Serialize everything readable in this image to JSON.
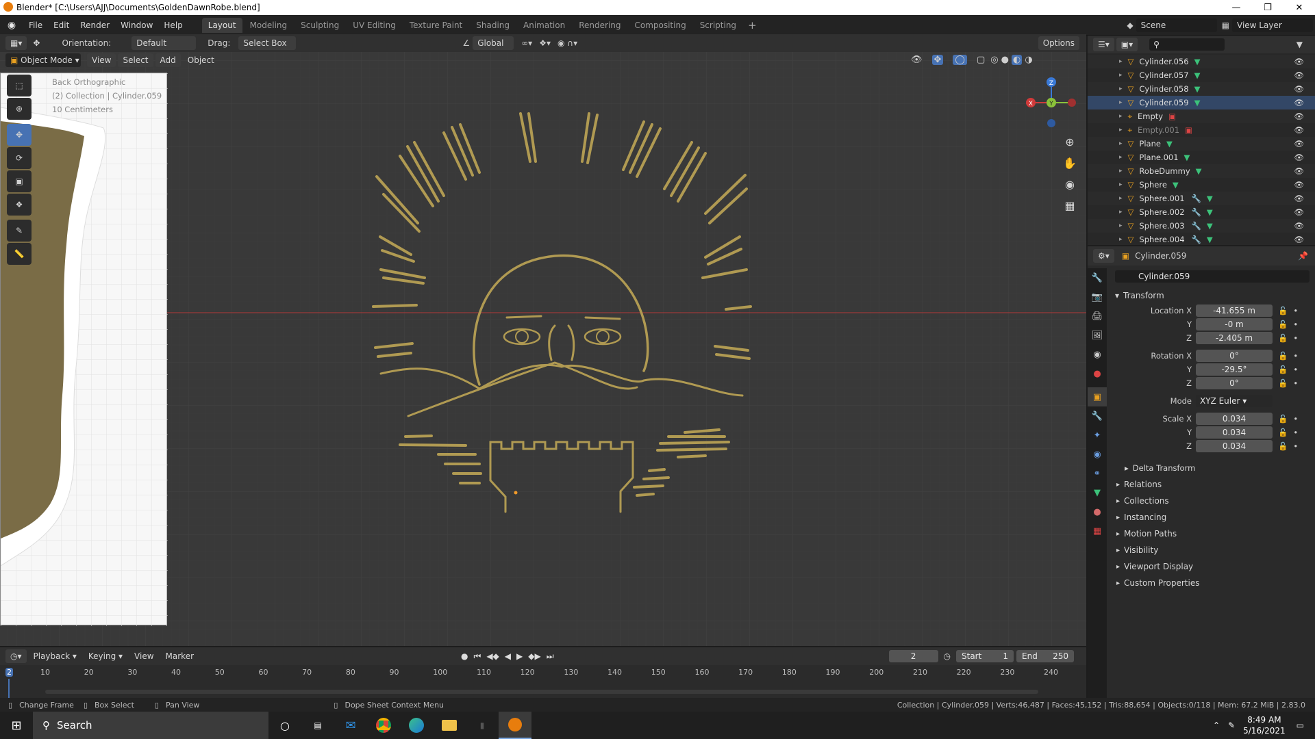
{
  "window": {
    "title": "Blender* [C:\\Users\\AJJ\\Documents\\GoldenDawnRobe.blend]"
  },
  "menu": [
    "File",
    "Edit",
    "Render",
    "Window",
    "Help"
  ],
  "workspaces": [
    "Layout",
    "Modeling",
    "Sculpting",
    "UV Editing",
    "Texture Paint",
    "Shading",
    "Animation",
    "Rendering",
    "Compositing",
    "Scripting"
  ],
  "scene": {
    "name": "Scene",
    "view_layer": "View Layer"
  },
  "tool_header": {
    "orientation_label": "Orientation:",
    "orientation_value": "Default",
    "drag_label": "Drag:",
    "drag_value": "Select Box",
    "transform_orientation": "Global",
    "options": "Options"
  },
  "viewport_header": {
    "mode": "Object Mode",
    "view": "View",
    "select": "Select",
    "add": "Add",
    "object": "Object"
  },
  "viewport_overlay": {
    "line1": "Back Orthographic",
    "line2": "(2) Collection | Cylinder.059",
    "line3": "10 Centimeters"
  },
  "gizmo": {
    "z": "Z",
    "y": "Y",
    "x": "X"
  },
  "outliner": {
    "items": [
      {
        "name": "Cylinder.056"
      },
      {
        "name": "Cylinder.057"
      },
      {
        "name": "Cylinder.058"
      },
      {
        "name": "Cylinder.059"
      },
      {
        "name": "Empty"
      },
      {
        "name": "Empty.001"
      },
      {
        "name": "Plane"
      },
      {
        "name": "Plane.001"
      },
      {
        "name": "RobeDummy"
      },
      {
        "name": "Sphere"
      },
      {
        "name": "Sphere.001"
      },
      {
        "name": "Sphere.002"
      },
      {
        "name": "Sphere.003"
      },
      {
        "name": "Sphere.004"
      }
    ]
  },
  "properties": {
    "header_object": "Cylinder.059",
    "object_name": "Cylinder.059",
    "transform_title": "Transform",
    "location_x_label": "Location X",
    "location_x": "-41.655 m",
    "location_y": "-0 m",
    "location_z": "-2.405 m",
    "rotation_x_label": "Rotation X",
    "rotation_x": "0°",
    "rotation_y": "-29.5°",
    "rotation_z": "0°",
    "mode_label": "Mode",
    "mode_value": "XYZ Euler",
    "scale_x_label": "Scale X",
    "scale_x": "0.034",
    "scale_y": "0.034",
    "scale_z": "0.034",
    "y_label": "Y",
    "z_label": "Z",
    "delta_transform": "Delta Transform",
    "sections": [
      "Relations",
      "Collections",
      "Instancing",
      "Motion Paths",
      "Visibility",
      "Viewport Display",
      "Custom Properties"
    ]
  },
  "timeline": {
    "playback": "Playback",
    "keying": "Keying",
    "view": "View",
    "marker": "Marker",
    "current_frame": "2",
    "start_label": "Start",
    "start": "1",
    "end_label": "End",
    "end": "250",
    "ticks": [
      "2",
      "10",
      "20",
      "30",
      "40",
      "50",
      "60",
      "70",
      "80",
      "90",
      "100",
      "110",
      "120",
      "130",
      "140",
      "150",
      "160",
      "170",
      "180",
      "190",
      "200",
      "210",
      "220",
      "230",
      "240"
    ]
  },
  "statusbar": {
    "change_frame": "Change Frame",
    "box_select": "Box Select",
    "pan_view": "Pan View",
    "context_menu": "Dope Sheet Context Menu",
    "stats": "Collection | Cylinder.059 | Verts:46,487 | Faces:45,152 | Tris:88,654 | Objects:0/118 | Mem: 67.2 MiB | 2.83.0"
  },
  "taskbar": {
    "search": "Search",
    "time": "8:49 AM",
    "date": "5/16/2021"
  },
  "colors": {
    "accent": "#4772b3",
    "gold": "#b09a52",
    "robe": "#7a6c46",
    "x_axis": "#d03a3a",
    "y_axis": "#8ac23a",
    "z_axis": "#3a7ad8"
  }
}
